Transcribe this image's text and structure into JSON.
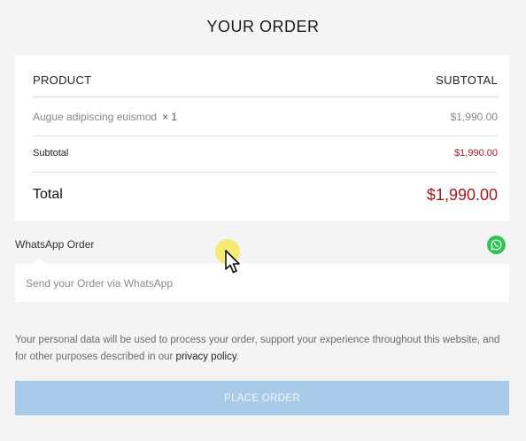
{
  "page": {
    "title": "YOUR ORDER"
  },
  "order_table": {
    "header": {
      "product": "PRODUCT",
      "subtotal": "SUBTOTAL"
    },
    "items": [
      {
        "name": "Augue adipiscing euismod",
        "qty": "× 1",
        "price": "$1,990.00"
      }
    ],
    "subtotal": {
      "label": "Subtotal",
      "value": "$1,990.00"
    },
    "total": {
      "label": "Total",
      "value": "$1,990.00"
    }
  },
  "whatsapp": {
    "label": "WhatsApp Order",
    "placeholder": "Send your Order via WhatsApp",
    "icon": "whatsapp-icon"
  },
  "privacy": {
    "text": "Your personal data will be used to process your order, support your experience throughout this website, and for other purposes described in our ",
    "link": "privacy policy",
    "end": "."
  },
  "checkout": {
    "place_order_label": "PLACE ORDER"
  },
  "colors": {
    "accent_price": "#a01a22",
    "button_bg": "#a8cbea",
    "whatsapp_green": "#2fc455"
  }
}
